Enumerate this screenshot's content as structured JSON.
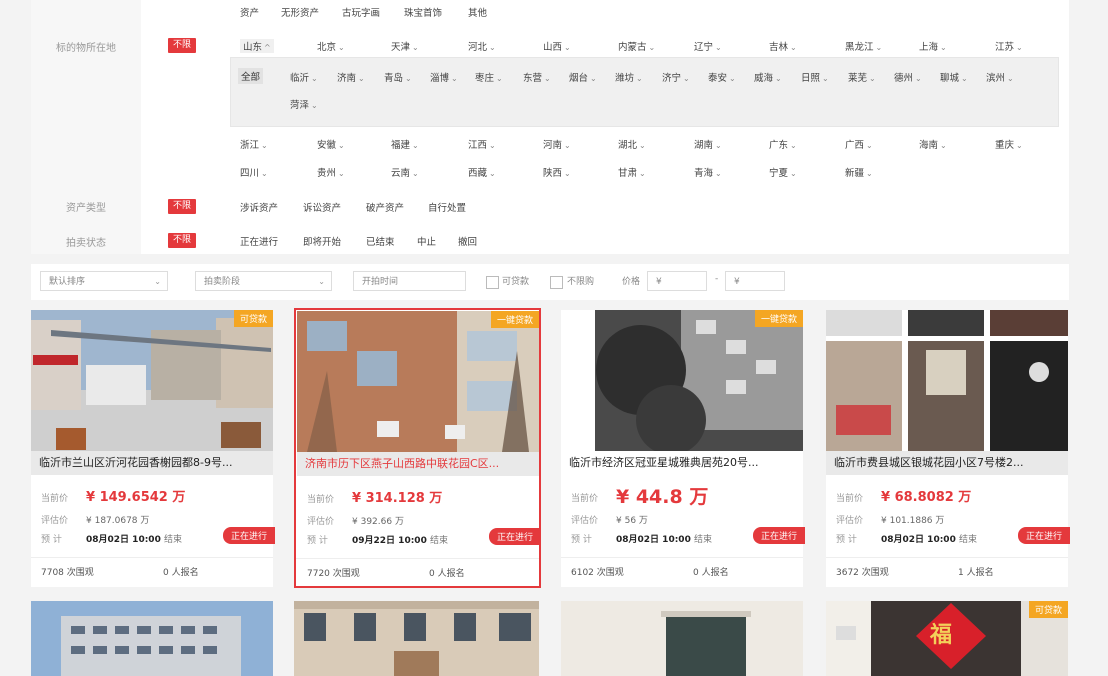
{
  "filter": {
    "top_row": [
      "资产",
      "无形资产",
      "古玩字画",
      "珠宝首饰",
      "其他"
    ],
    "location_label": "标的物所在地",
    "no_limit": "不限",
    "provinces_row1": [
      "山东",
      "北京",
      "天津",
      "河北",
      "山西",
      "内蒙古",
      "辽宁",
      "吉林",
      "黑龙江",
      "上海",
      "江苏"
    ],
    "all_label": "全部",
    "cities": [
      "临沂",
      "济南",
      "青岛",
      "淄博",
      "枣庄",
      "东营",
      "烟台",
      "潍坊",
      "济宁",
      "泰安",
      "威海",
      "日照",
      "莱芜",
      "德州",
      "聊城",
      "滨州",
      "菏泽"
    ],
    "provinces_row2": [
      "浙江",
      "安徽",
      "福建",
      "江西",
      "河南",
      "湖北",
      "湖南",
      "广东",
      "广西",
      "海南",
      "重庆"
    ],
    "provinces_row3": [
      "四川",
      "贵州",
      "云南",
      "西藏",
      "陕西",
      "甘肃",
      "青海",
      "宁夏",
      "新疆"
    ],
    "asset_type_label": "资产类型",
    "asset_types": [
      "涉诉资产",
      "诉讼资产",
      "破产资产",
      "自行处置"
    ],
    "auction_status_label": "拍卖状态",
    "auction_statuses": [
      "正在进行",
      "即将开始",
      "已结束",
      "中止",
      "撤回"
    ]
  },
  "sortbar": {
    "default_sort": "默认排序",
    "auction_stage": "拍卖阶段",
    "start_time": "开拍时间",
    "loan_ok": "可贷款",
    "no_limit_buy": "不限购",
    "price_label": "价格",
    "price_min": "¥",
    "price_sep": "-",
    "price_max": "¥"
  },
  "labels": {
    "current_price": "当前价",
    "appraisal": "评估价",
    "estimated": "预 计",
    "end_suffix": "结束",
    "views_suffix": "次围观",
    "signup_suffix": "人报名",
    "status": "正在进行"
  },
  "cards": [
    {
      "tag": "可贷款",
      "title": "临沂市兰山区沂河花园香榭园都8-9号...",
      "price": "¥ 149.6542 万",
      "appraisal": "¥ 187.0678 万",
      "end_time": "08月02日 10:00",
      "views": "7708",
      "signups": "0"
    },
    {
      "tag": "一键贷款",
      "title": "济南市历下区燕子山西路中联花园C区...",
      "price": "¥ 314.128 万",
      "appraisal": "¥ 392.66 万",
      "end_time": "09月22日 10:00",
      "views": "7720",
      "signups": "0"
    },
    {
      "tag": "一键贷款",
      "title": "临沂市经济区冠亚星城雅典居苑20号...",
      "price": "¥ 44.8 万",
      "appraisal": "¥ 56 万",
      "end_time": "08月02日 10:00",
      "views": "6102",
      "signups": "0"
    },
    {
      "tag": "",
      "title": "临沂市费县城区银城花园小区7号楼2...",
      "price": "¥ 68.8082 万",
      "appraisal": "¥ 101.1886 万",
      "end_time": "08月02日 10:00",
      "views": "3672",
      "signups": "1"
    }
  ],
  "row2": {
    "tag4": "可贷款",
    "fu": "福"
  }
}
